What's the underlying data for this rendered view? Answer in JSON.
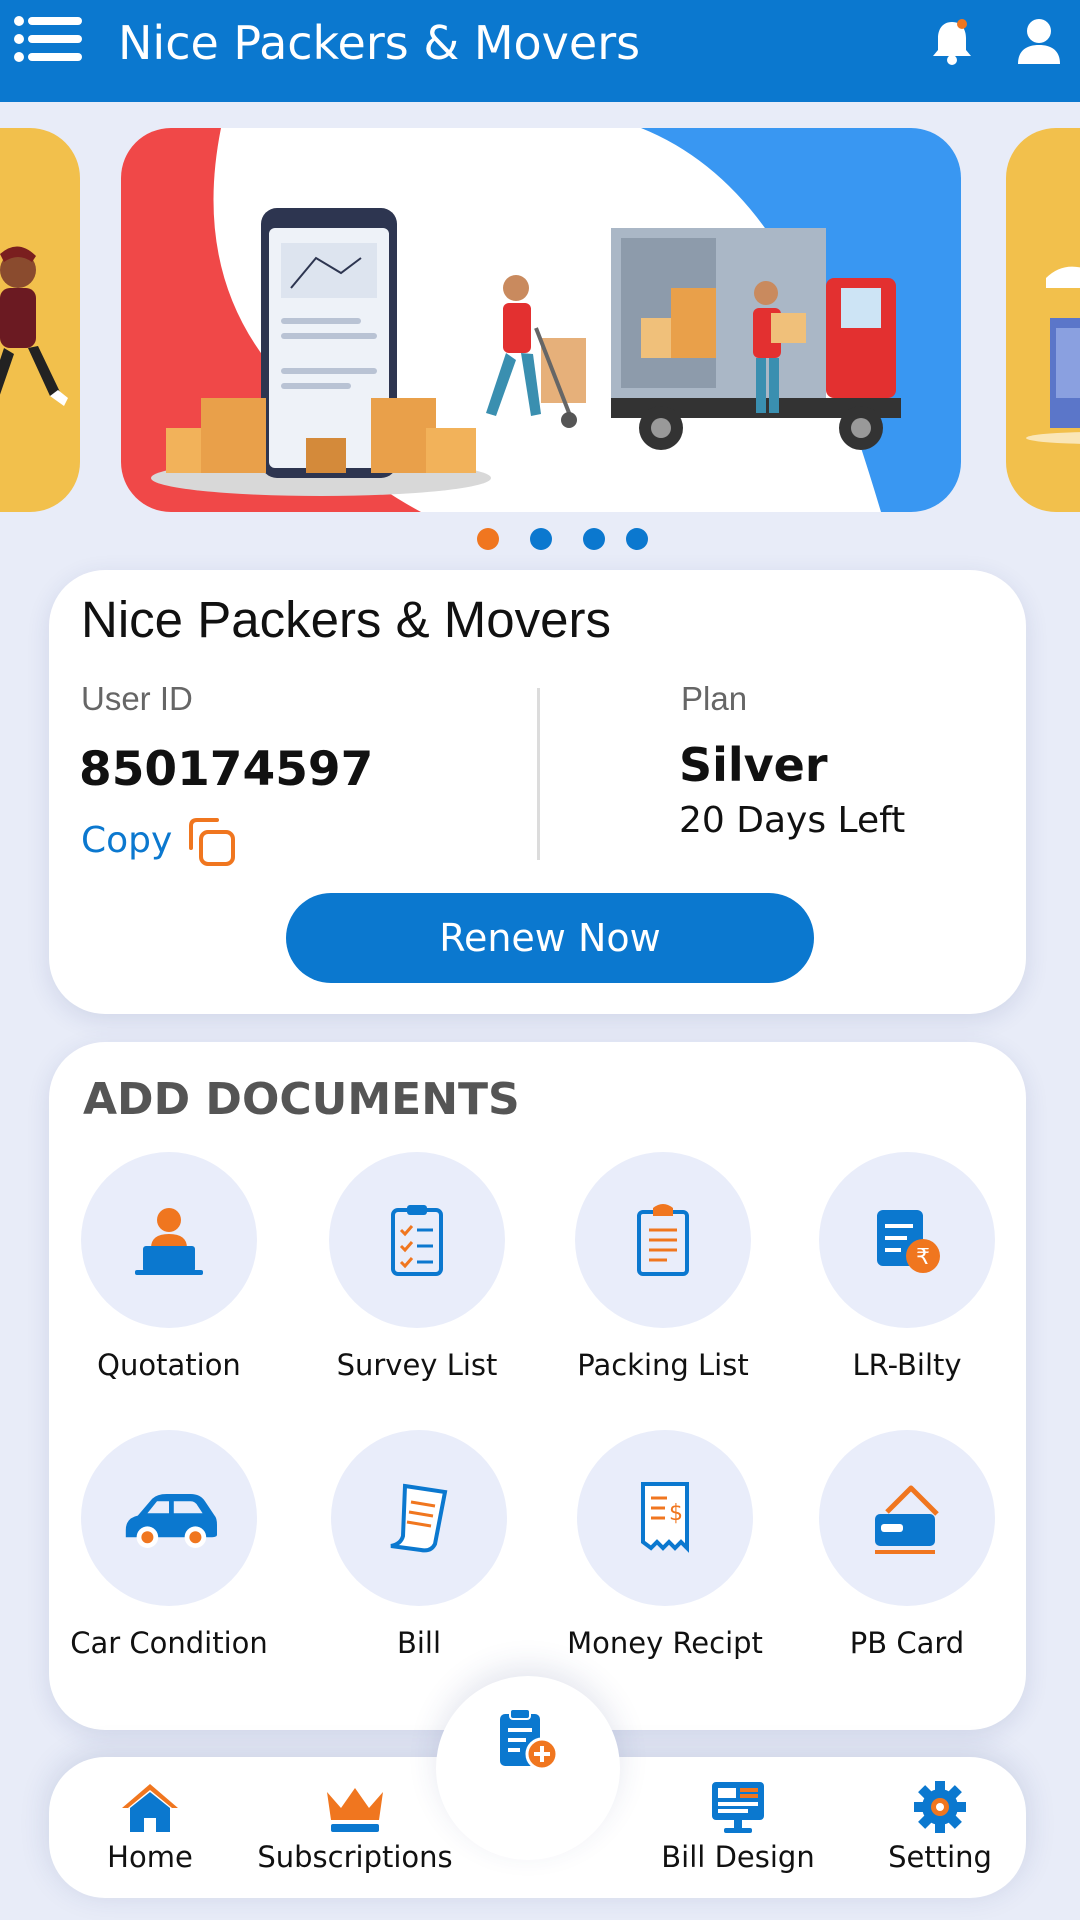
{
  "header": {
    "title": "Nice Packers & Movers",
    "icons": [
      "menu-icon",
      "bell-icon",
      "user-icon"
    ]
  },
  "carousel": {
    "slide_count": 4,
    "active_index": 0
  },
  "account": {
    "company_name": "Nice Packers & Movers",
    "user_id_label": "User ID",
    "user_id": "850174597",
    "copy_label": "Copy",
    "plan_label": "Plan",
    "plan": "Silver",
    "days_left": "20 Days Left",
    "renew_label": "Renew Now"
  },
  "documents": {
    "title": "ADD DOCUMENTS",
    "items": [
      {
        "label": "Quotation",
        "icon": "quotation-icon"
      },
      {
        "label": "Survey List",
        "icon": "survey-list-icon"
      },
      {
        "label": "Packing List",
        "icon": "packing-list-icon"
      },
      {
        "label": "LR-Bilty",
        "icon": "lr-bilty-icon"
      },
      {
        "label": "Car Condition",
        "icon": "car-icon"
      },
      {
        "label": "Bill",
        "icon": "bill-icon"
      },
      {
        "label": "Money Recipt",
        "icon": "money-receipt-icon"
      },
      {
        "label": "PB Card",
        "icon": "pb-card-icon"
      }
    ]
  },
  "bottom_nav": {
    "items": [
      {
        "label": "Home",
        "icon": "home-icon"
      },
      {
        "label": "Subscriptions",
        "icon": "crown-icon"
      },
      {
        "label": "Bill Design",
        "icon": "monitor-icon"
      },
      {
        "label": "Setting",
        "icon": "gear-icon"
      }
    ],
    "fab_icon": "add-document-icon"
  },
  "colors": {
    "primary": "#0b78cf",
    "accent": "#f0761f",
    "background": "#e8ecf8",
    "icon_circle": "#e9edfa"
  }
}
